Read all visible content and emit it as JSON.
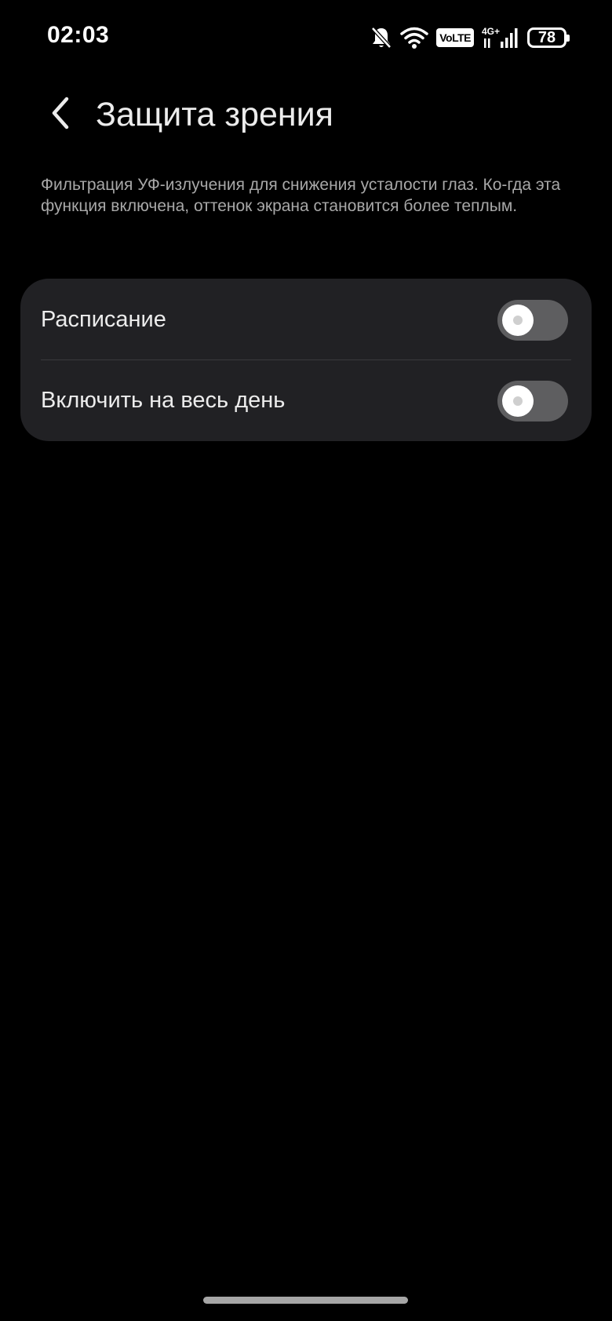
{
  "status_bar": {
    "time": "02:03",
    "volte_label": "VoLTE",
    "network_label": "4G+",
    "battery_level": "78",
    "icons": [
      "bell-off-icon",
      "wifi-icon",
      "volte-icon",
      "signal-icon",
      "battery-icon"
    ]
  },
  "header": {
    "back_icon": "chevron-left-icon",
    "title": "Защита зрения"
  },
  "description": "Фильтрация УФ-излучения для снижения усталости глаз. Ко-гда эта функция включена, оттенок экрана становится более теплым.",
  "settings": [
    {
      "label": "Расписание",
      "enabled": false
    },
    {
      "label": "Включить на весь день",
      "enabled": false
    }
  ],
  "colors": {
    "background": "#000000",
    "card": "#212124",
    "toggle_off_track": "#5e5e60",
    "text_primary": "#ececec",
    "text_secondary": "#a8a8a8"
  }
}
